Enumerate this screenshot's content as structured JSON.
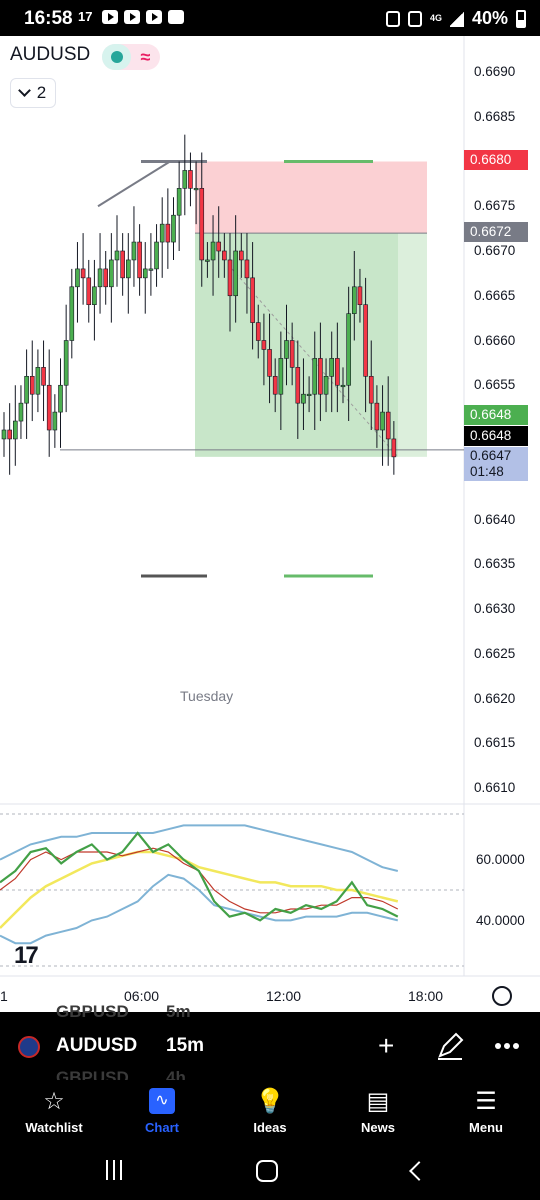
{
  "status_bar": {
    "time": "16:58",
    "network": "4G",
    "battery": "40%"
  },
  "chart": {
    "symbol": "AUDUSD",
    "indicator_count": "2",
    "price_axis": [
      "0.6690",
      "0.6685",
      "0.6675",
      "0.6670",
      "0.6665",
      "0.6660",
      "0.6655",
      "0.6640",
      "0.6635",
      "0.6630",
      "0.6625",
      "0.6620",
      "0.6615",
      "0.6610"
    ],
    "price_tags": {
      "stop_loss": "0.6680",
      "entry": "0.6672",
      "last_green": "0.6648",
      "last_black": "0.6648",
      "current": "0.6647",
      "countdown": "01:48"
    },
    "day_label": "Tuesday",
    "oscillator_axis": [
      "60.0000",
      "40.0000"
    ],
    "time_axis": [
      "1",
      "06:00",
      "12:00",
      "18:00"
    ],
    "colors": {
      "up": "#4caf50",
      "down": "#f23645",
      "target_zone": "#c8e6c9",
      "stop_zone": "#fbd0d3",
      "accent": "#2962ff"
    }
  },
  "chart_data": {
    "type": "candlestick",
    "symbol": "AUDUSD",
    "interval": "15m",
    "ylim": [
      0.6607,
      0.6693
    ],
    "position": {
      "entry": 0.6672,
      "stop": 0.668,
      "target": 0.6647
    },
    "close_series": [
      0.665,
      0.6649,
      0.6651,
      0.6653,
      0.6656,
      0.6654,
      0.6657,
      0.6655,
      0.665,
      0.6652,
      0.6655,
      0.666,
      0.6666,
      0.6668,
      0.6667,
      0.6664,
      0.6666,
      0.6668,
      0.6666,
      0.6669,
      0.667,
      0.6667,
      0.6669,
      0.6671,
      0.6667,
      0.6668,
      0.6668,
      0.6671,
      0.6673,
      0.6671,
      0.6674,
      0.6677,
      0.6679,
      0.6677,
      0.6677,
      0.6669,
      0.6669,
      0.6671,
      0.667,
      0.6669,
      0.6665,
      0.667,
      0.6669,
      0.6667,
      0.6662,
      0.666,
      0.6659,
      0.6656,
      0.6654,
      0.6658,
      0.666,
      0.6657,
      0.6653,
      0.6654,
      0.6654,
      0.6658,
      0.6654,
      0.6656,
      0.6658,
      0.6655,
      0.6655,
      0.6663,
      0.6666,
      0.6664,
      0.6656,
      0.6653,
      0.665,
      0.6652,
      0.6649,
      0.6647
    ]
  },
  "oscillator_data": {
    "green": [
      52,
      55,
      60,
      61,
      57,
      60,
      62,
      58,
      60,
      65,
      60,
      62,
      58,
      55,
      47,
      43,
      44,
      42,
      45,
      44,
      46,
      45,
      47,
      52,
      46,
      45,
      43
    ],
    "red": [
      50,
      53,
      58,
      60,
      58,
      60,
      60,
      60,
      59,
      60,
      61,
      60,
      57,
      55,
      50,
      47,
      45,
      44,
      44,
      45,
      45,
      46,
      46,
      48,
      48,
      47,
      45
    ],
    "yellow": [
      40,
      44,
      48,
      51,
      53,
      55,
      57,
      58,
      59,
      60,
      60,
      59,
      58,
      56,
      55,
      54,
      53,
      52,
      52,
      51,
      51,
      51,
      50,
      50,
      49,
      48,
      47
    ],
    "upper": [
      58,
      60,
      62,
      63,
      64,
      64,
      65,
      65,
      65,
      65,
      65,
      66,
      67,
      67,
      67,
      67,
      67,
      66,
      65,
      64,
      63,
      62,
      61,
      60,
      58,
      56,
      55
    ],
    "lower": [
      38,
      36,
      36,
      38,
      39,
      40,
      42,
      43,
      45,
      47,
      51,
      54,
      53,
      50,
      46,
      45,
      44,
      43,
      42,
      42,
      43,
      43,
      43,
      44,
      44,
      43,
      42
    ]
  },
  "symbol_bar": {
    "symbol": "AUDUSD",
    "interval": "15m",
    "ghost_symbol_top": "GBPUSD",
    "ghost_interval_top": "5m",
    "ghost_symbol_bottom": "GBPUSD",
    "ghost_interval_bottom": "4h"
  },
  "bottom_nav": {
    "items": [
      {
        "label": "Watchlist",
        "icon": "star-icon"
      },
      {
        "label": "Chart",
        "icon": "chart-icon"
      },
      {
        "label": "Ideas",
        "icon": "lightbulb-icon"
      },
      {
        "label": "News",
        "icon": "news-icon"
      },
      {
        "label": "Menu",
        "icon": "menu-icon"
      }
    ]
  }
}
